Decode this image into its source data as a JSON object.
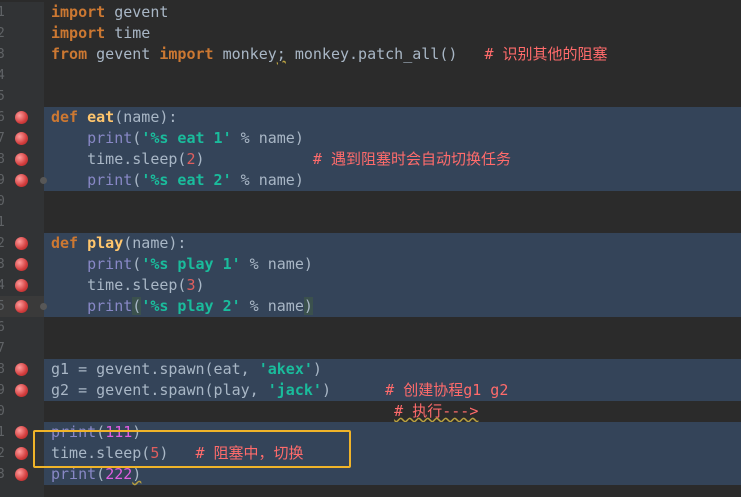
{
  "line_numbers": [
    "1",
    "2",
    "3",
    "4",
    "5",
    "6",
    "7",
    "8",
    "9",
    "0",
    "1",
    "2",
    "3",
    "4",
    "5",
    "6",
    "7",
    "8",
    "9",
    "0",
    "1",
    "2",
    "3"
  ],
  "code": {
    "l1": {
      "kw": "import",
      "rest": " gevent"
    },
    "l2": {
      "kw": "import",
      "rest": " time"
    },
    "l3": {
      "kw1": "from",
      "a": " gevent ",
      "kw2": "import",
      "b": " monkey",
      "semi": ";",
      "c": " monkey.patch_all()",
      "comment": "   # 识别其他的阻塞"
    },
    "l5": {
      "kw": "def",
      "sp": " ",
      "fn": "eat",
      "rest": "(name):"
    },
    "l6": {
      "indent": "    ",
      "bi": "print",
      "p1": "(",
      "str": "'%s eat 1'",
      "p2": " % name)"
    },
    "l7": {
      "indent": "    ",
      "a": "time.sleep(",
      "num": "2",
      "b": ")",
      "comment": "            # 遇到阻塞时会自动切换任务"
    },
    "l8": {
      "indent": "    ",
      "bi": "print",
      "p1": "(",
      "str": "'%s eat 2'",
      "p2": " % name)"
    },
    "l10": {
      "kw": "def",
      "sp": " ",
      "fn": "play",
      "rest": "(name):"
    },
    "l11": {
      "indent": "    ",
      "bi": "print",
      "p1": "(",
      "str": "'%s play 1'",
      "p2": " % name)"
    },
    "l12": {
      "indent": "    ",
      "a": "time.sleep(",
      "num": "3",
      "b": ")"
    },
    "l13": {
      "indent": "    ",
      "bi": "print",
      "p1": "(",
      "str": "'%s play 2'",
      "p2": " % name",
      "p3": ")"
    },
    "l16": {
      "a": "g1 = gevent.spawn(eat, ",
      "str": "'akex'",
      "b": ")"
    },
    "l17": {
      "a": "g2 = gevent.spawn(play, ",
      "str": "'jack'",
      "b": ")",
      "comment": "      # 创建协程g1 g2"
    },
    "l18": {
      "pad": "                                      ",
      "comment": "# 执行--->"
    },
    "l19": {
      "bi": "print",
      "p1": "(",
      "num": "111",
      "p2": ")"
    },
    "l20": {
      "a": "time.sleep(",
      "num": "5",
      "b": ")",
      "comment": "   # 阻塞中，切换"
    },
    "l21": {
      "bi": "print",
      "p1": "(",
      "num": "222",
      "p2": ")"
    }
  },
  "colors": {
    "background": "#2b2b2b",
    "keyword": "#cc7832",
    "string": "#1abc9c",
    "comment": "#ff6b6b",
    "number": "#e05e5e",
    "highlight": "#344459",
    "annotation_box": "#f0b429"
  },
  "icons": [
    "breakpoint-icon",
    "fold-marker-icon"
  ]
}
